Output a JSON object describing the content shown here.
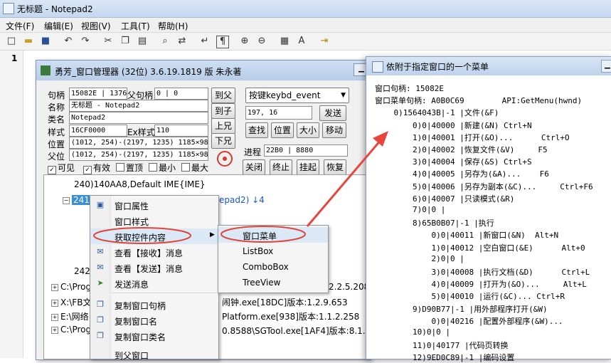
{
  "notepad": {
    "title": "无标题 - Notepad2",
    "menu": [
      "文件(F)",
      "编辑(E)",
      "视图(V)",
      "工具(T)",
      "帮助(H)"
    ],
    "line_number": "1"
  },
  "winmgr": {
    "title": "勇芳_窗口管理器 (32位) 3.6.19.1819 版 朱永著",
    "labels": {
      "handle": "句柄",
      "parent_handle": "父句柄",
      "name": "名称",
      "class": "类名",
      "style": "样式",
      "ex_style": "Ex样式",
      "position": "位置",
      "parent_pos": "父位",
      "process": "进程"
    },
    "values": {
      "handle": "15082E | 1376",
      "parent_handle": "0 | 0",
      "name": "无标题 - Notepad2",
      "class": "Notepad2",
      "style": "16CF0000",
      "ex_style": "110",
      "position": "(1012, 254)-(2197, 1235) 1185×981",
      "parent_pos": "(1012, 254)-(2197, 1235) 1185×981",
      "coords": "197, 16",
      "process": "22B0 | 8880"
    },
    "buttons": {
      "to_parent": "到父",
      "to_child": "到子",
      "up": "上兄",
      "down": "下兄",
      "send": "发送",
      "find": "查找",
      "position": "位置",
      "size": "大小",
      "move": "移动",
      "close": "关闭",
      "terminate": "终止",
      "suspend": "挂起",
      "restore": "恢复"
    },
    "dropdown": "按键keybd_event",
    "checkboxes": [
      {
        "label": "可见",
        "checked": true
      },
      {
        "label": "有效",
        "checked": true
      },
      {
        "label": "置顶",
        "checked": false
      },
      {
        "label": "最小",
        "checked": false
      },
      {
        "label": "最大",
        "checked": false
      }
    ],
    "tree": {
      "row1": "240)140AA8,Default IME{IME}",
      "row2_start": "241",
      "row2_end": "epad2) ↓4",
      "row3": "242",
      "row4a": "C:\\Prog",
      "row4b": "2.2.5.208",
      "row5a": "X:\\FB文",
      "row5b": "闹钟.exe[18DC]版本:1.2.9.653",
      "row6a": "E:\\网络",
      "row6b": "Platform.exe[938]版本:1.1.2.258",
      "row7a": "C:\\Prog",
      "row7b": "0.8588\\SGTool.exe[1AF4]版本:8.1.0."
    }
  },
  "context_menu": {
    "items": [
      "窗口属性",
      "窗口样式",
      "获取控件内容",
      "查看【接收】消息",
      "查看【发送】消息",
      "发送消息",
      "复制窗口句柄",
      "复制窗口名",
      "复制窗口类名",
      "到父窗口"
    ],
    "submenu": [
      "窗口菜单",
      "ListBox",
      "ComboBox",
      "TreeView"
    ]
  },
  "popup": {
    "title": "依附于指定窗口的一个菜单",
    "lines": [
      "窗口句柄: 15082E",
      "窗口菜单句柄: A0B0C69        API:GetMenu(hwnd)",
      "    0)1564043B|-1 |文件(&F)",
      "        0)0|40000 |新建(&N) Ctrl+N",
      "        1)0|40001 |打开(&O)...      Ctrl+O",
      "        2)0|40002 |恢复文件(&V)     F5",
      "        3)0|40004 |保存(&S) Ctrl+S",
      "        4)0|40005 |另存为(&A)...    F6",
      "        5)0|40006 |另存为副本(&C)...     Ctrl+F6",
      "        6)0|40007 |只读模式(&R)",
      "        7)0|0 |",
      "        8)65B0B07|-1 |执行",
      "            0)0|40011 |新窗口(&N)  Alt+N",
      "            1)0|40012 |空白窗口(&E)      Alt+0",
      "            2)0|0 |",
      "            3)0|40008 |执行文档(&D)      Ctrl+L",
      "            4)0|40009 |打开为(&O)...     Alt+L",
      "            5)0|40010 |运行(&C)... Ctrl+R",
      "        9)D90B77|-1 |用外部程序打开(&W)",
      "            0)0|40216 |配置外部程序(&W)...",
      "        10)0|0 |",
      "        11)0|40177 |代码页转换",
      "        12)9ED0C89|-1 |编码设置"
    ]
  },
  "colors": {
    "arrow": "#e8463c",
    "ellipse": "#e0443a",
    "accent": "#3a8fd8"
  }
}
